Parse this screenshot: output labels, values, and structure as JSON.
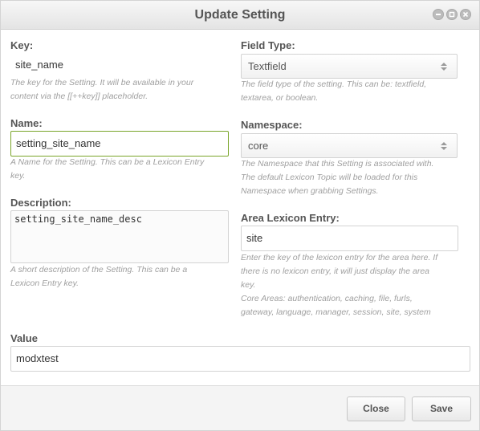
{
  "window": {
    "title": "Update Setting"
  },
  "key": {
    "label": "Key:",
    "value": "site_name",
    "help": [
      "The key for the Setting. It will be available in your",
      "content via the [[++key]] placeholder."
    ]
  },
  "name": {
    "label": "Name:",
    "value": "setting_site_name",
    "help": [
      "A Name for the Setting. This can be a Lexicon Entry",
      "key."
    ]
  },
  "description": {
    "label": "Description:",
    "value": "setting_site_name_desc",
    "help": [
      "A short description of the Setting. This can be a",
      "Lexicon Entry key."
    ]
  },
  "field_type": {
    "label": "Field Type:",
    "value": "Textfield",
    "help": [
      "The field type of the setting. This can be: textfield,",
      "textarea, or boolean."
    ]
  },
  "namespace": {
    "label": "Namespace:",
    "value": "core",
    "help": [
      "The Namespace that this Setting is associated with.",
      "The default Lexicon Topic will be loaded for this",
      "Namespace when grabbing Settings."
    ]
  },
  "area": {
    "label": "Area Lexicon Entry:",
    "value": "site",
    "help": [
      "Enter the key of the lexicon entry for the area here. If",
      "there is no lexicon entry, it will just display the area",
      "key.",
      "Core Areas: authentication, caching, file, furls,",
      "gateway, language, manager, session, site, system"
    ]
  },
  "value_field": {
    "label": "Value",
    "value": "modxtest"
  },
  "buttons": {
    "close": "Close",
    "save": "Save"
  },
  "icons": {
    "minimize": "minimize-icon",
    "maximize": "maximize-icon",
    "close": "close-icon",
    "select_arrows": "updown-arrows-icon"
  },
  "colors": {
    "focus_border": "#7aa52a"
  }
}
